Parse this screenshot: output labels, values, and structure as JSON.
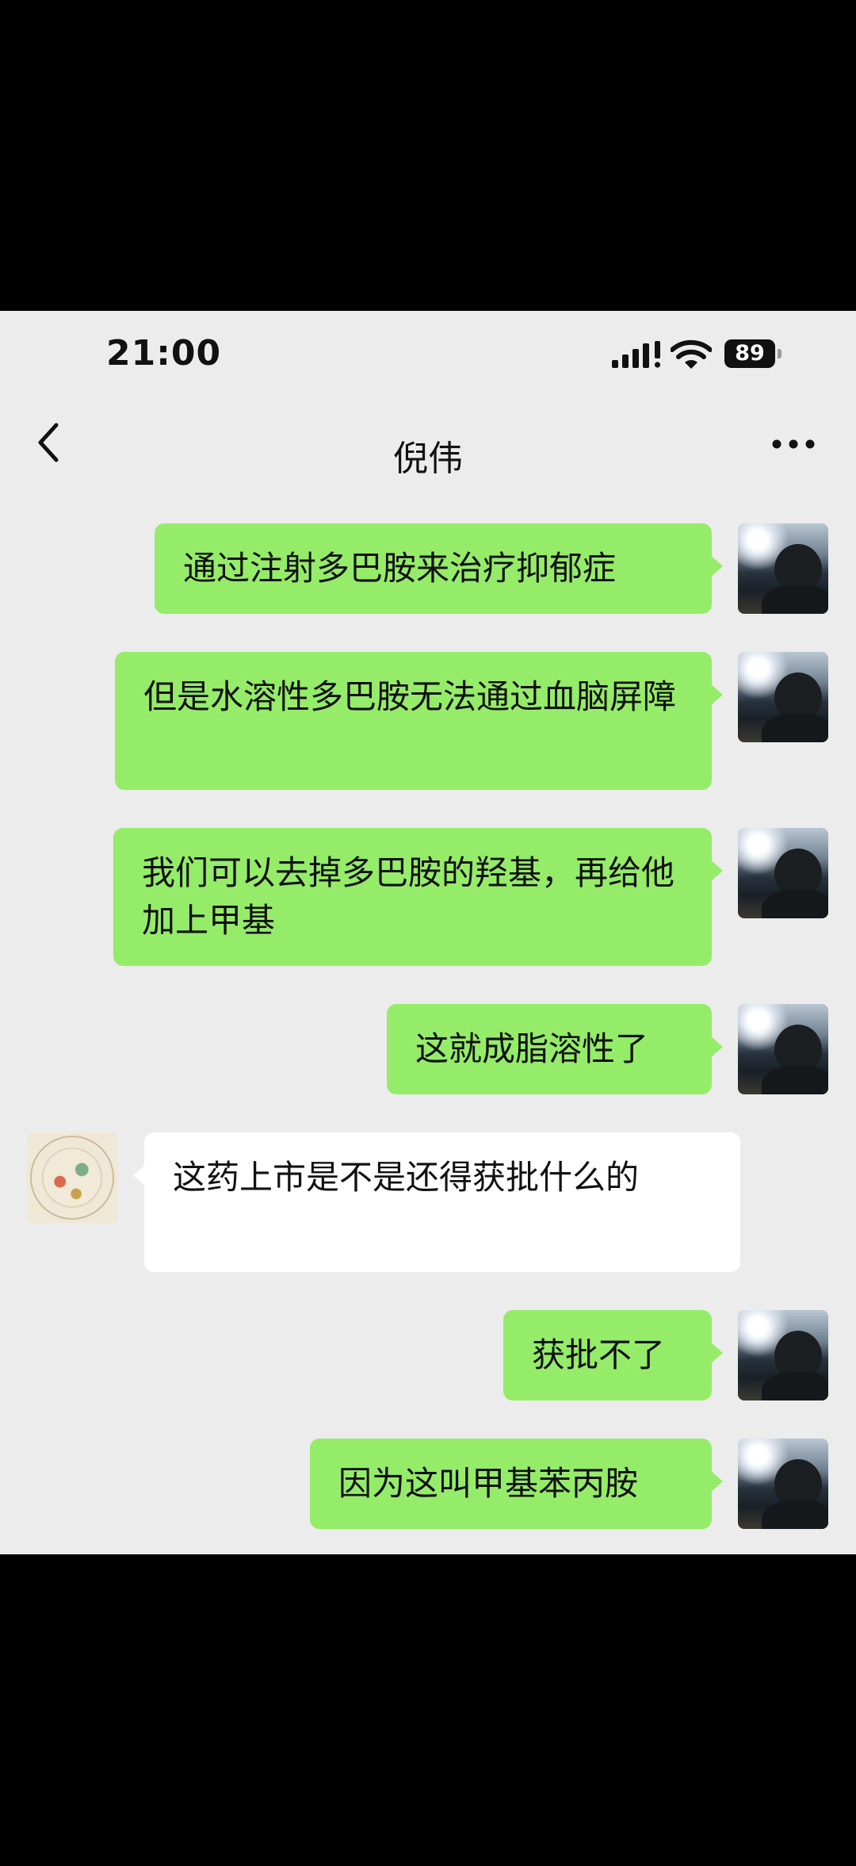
{
  "status_bar": {
    "time": "21:00",
    "battery": "89"
  },
  "header": {
    "title": "倪伟"
  },
  "messages": [
    {
      "from": "me",
      "text": "通过注射多巴胺来治疗抑郁症"
    },
    {
      "from": "me",
      "text": "但是水溶性多巴胺无法通过血脑屏障"
    },
    {
      "from": "me",
      "text": "我们可以去掉多巴胺的羟基，再给他加上甲基"
    },
    {
      "from": "me",
      "text": "这就成脂溶性了"
    },
    {
      "from": "other",
      "text": "这药上市是不是还得获批什么的"
    },
    {
      "from": "me",
      "text": "获批不了"
    },
    {
      "from": "me",
      "text": "因为这叫甲基苯丙胺"
    }
  ],
  "colors": {
    "sent_bubble": "#95ec69",
    "received_bubble": "#ffffff",
    "chat_bg": "#ececec"
  },
  "icons": {
    "back": "chevron-left-icon",
    "more": "more-dots-icon",
    "signal": "signal-icon",
    "wifi": "wifi-icon"
  }
}
